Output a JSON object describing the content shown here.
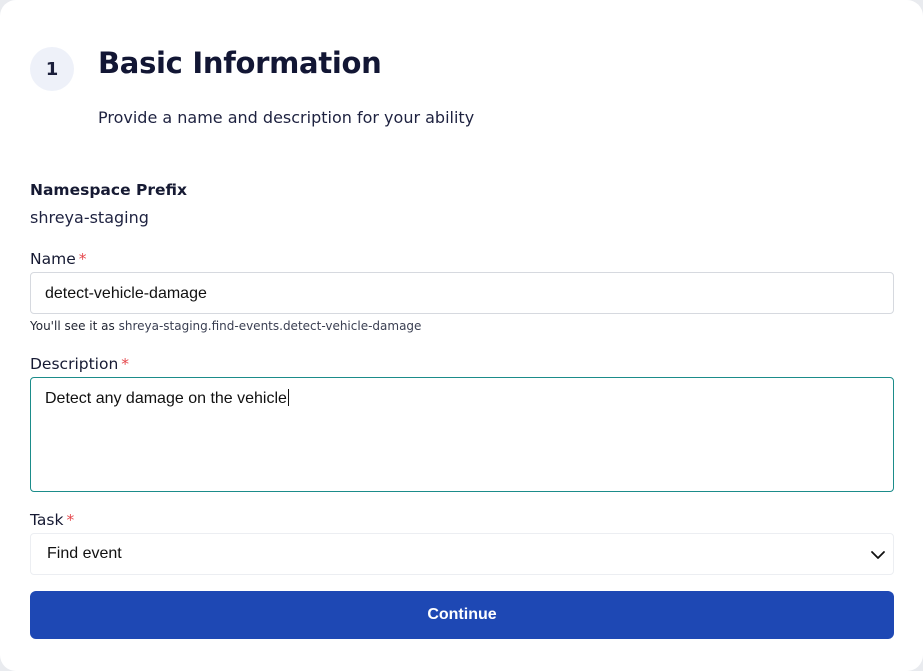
{
  "step": {
    "number": "1",
    "title": "Basic Information",
    "subtitle": "Provide a name and description for your ability"
  },
  "namespace": {
    "label": "Namespace Prefix",
    "value": "shreya-staging"
  },
  "name_field": {
    "label": "Name",
    "required_mark": "*",
    "value": "detect-vehicle-damage",
    "hint_prefix": "You'll see it as",
    "hint_value": "shreya-staging.find-events.detect-vehicle-damage"
  },
  "description_field": {
    "label": "Description",
    "required_mark": "*",
    "value": "Detect any damage on the vehicle"
  },
  "task_field": {
    "label": "Task",
    "required_mark": "*",
    "selected": "Find event",
    "icon": "chevron-down-icon"
  },
  "actions": {
    "continue_label": "Continue"
  },
  "colors": {
    "primary_button": "#1e48b4",
    "required": "#e5484d",
    "focus_border": "#1b8c8a",
    "title": "#121634"
  }
}
